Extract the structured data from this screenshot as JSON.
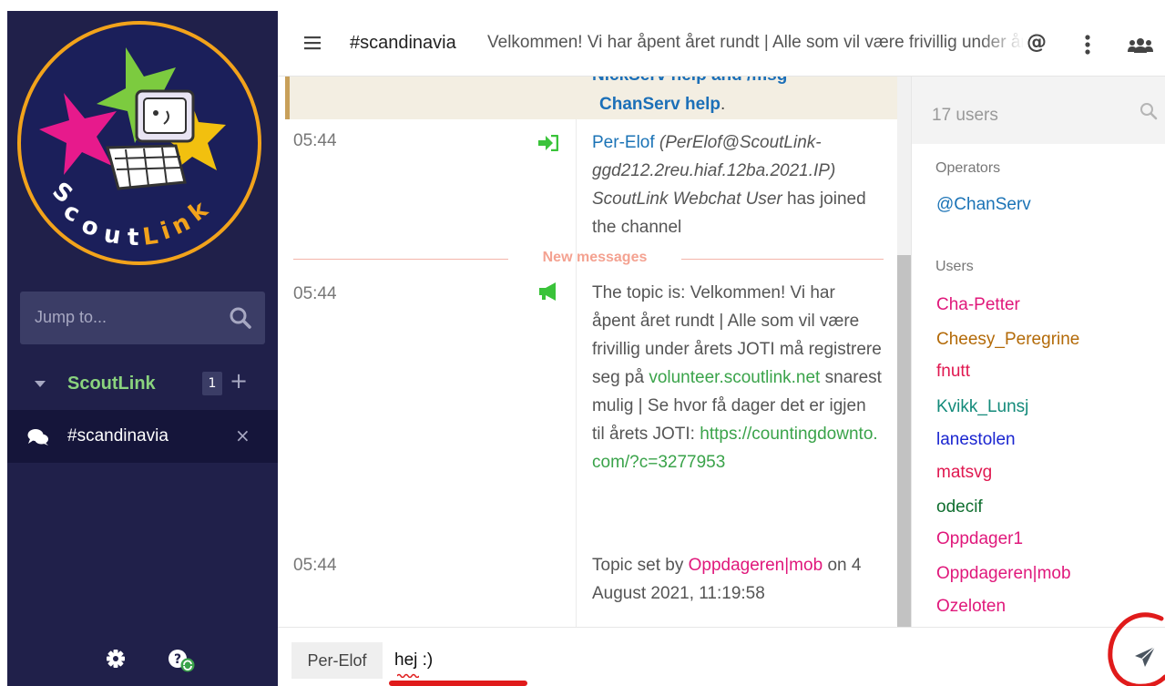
{
  "app": {
    "logo_text": "ScoutLink"
  },
  "sidebar": {
    "jump_placeholder": "Jump to...",
    "network_name": "ScoutLink",
    "network_unread": "1",
    "network_add": "+",
    "channel_name": "#scandinavia",
    "channel_close": "×"
  },
  "header": {
    "channel": "#scandinavia",
    "topic": "Velkommen! Vi har åpent året rundt | Alle som vil være frivillig under årets JOTI må registrere seg på volunteer.scoutlink.net snarest mulig",
    "at_label": "@"
  },
  "messages": {
    "motd_line1": "NickServ help and /msg",
    "motd_line2": "ChanServ help",
    "motd_dot": ".",
    "new_messages_label": "New messages",
    "join": {
      "time": "05:44",
      "nick": "Per-Elof",
      "host": "(PerElof@ScoutLink-ggd212.2reu.hiaf.12ba.2021.IP)",
      "realname": "ScoutLink Webchat User",
      "action": "has joined the channel"
    },
    "topic_msg": {
      "time": "05:44",
      "text_prefix": "The topic is: Velkommen! Vi har åpent året rundt | Alle som vil være frivillig under årets JOTI må registrere seg på",
      "link1": "volunteer.scoutlink.net",
      "text_mid": "snarest mulig | Se hvor få dager det er igjen til årets JOTI:",
      "link2": "https://countingdownto.com/?c=3277953"
    },
    "topic_set": {
      "time": "05:44",
      "prefix": "Topic set by",
      "nick": "Oppdageren|mob",
      "suffix": "on 4 August 2021, 11:19:58"
    }
  },
  "userlist": {
    "count_label": "17 users",
    "operators_label": "Operators",
    "users_label": "Users",
    "operators": [
      {
        "name": "@ChanServ",
        "color": "#1b73b6"
      }
    ],
    "users": [
      {
        "name": "Cha-Petter",
        "color": "#e0187b"
      },
      {
        "name": "Cheesy_Peregrine",
        "color": "#b36a08"
      },
      {
        "name": "fnutt",
        "color": "#e01850"
      },
      {
        "name": "Kvikk_Lunsj",
        "color": "#138a7a"
      },
      {
        "name": "lanestolen",
        "color": "#1a25d0"
      },
      {
        "name": "matsvg",
        "color": "#e01850"
      },
      {
        "name": "odecif",
        "color": "#0f6e2f"
      },
      {
        "name": "Oppdager1",
        "color": "#e0187b"
      },
      {
        "name": "Oppdageren|mob",
        "color": "#e0187b"
      },
      {
        "name": "Ozeloten",
        "color": "#e0187b"
      }
    ]
  },
  "input": {
    "nick": "Per-Elof",
    "value": "hej :)"
  },
  "colors": {
    "sidebar_bg": "#20204a",
    "network_green": "#8ad37e",
    "link_green": "#3aa34a",
    "annotation_red": "#e01b1b"
  }
}
